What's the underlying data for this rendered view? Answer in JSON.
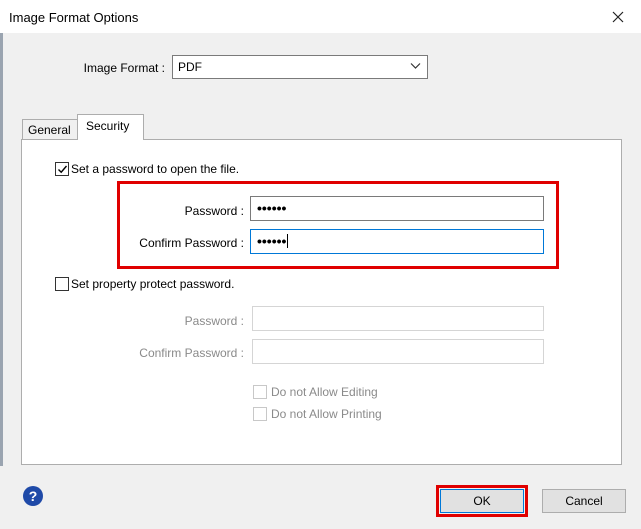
{
  "window": {
    "title": "Image Format Options"
  },
  "format": {
    "label": "Image Format :",
    "value": "PDF"
  },
  "tabs": {
    "general": "General",
    "security": "Security"
  },
  "open_password": {
    "checkbox_label": "Set a password to open the file.",
    "checked": true,
    "password_label": "Password :",
    "password_value": "••••••",
    "confirm_label": "Confirm Password :",
    "confirm_value": "••••••"
  },
  "property_password": {
    "checkbox_label": "Set property protect password.",
    "checked": false,
    "password_label": "Password :",
    "confirm_label": "Confirm Password :",
    "no_editing_label": "Do not Allow Editing",
    "no_printing_label": "Do not Allow Printing"
  },
  "buttons": {
    "ok": "OK",
    "cancel": "Cancel",
    "help": "?"
  },
  "colors": {
    "highlight": "#e00000",
    "focus": "#0078d7",
    "help": "#1f4aa8"
  }
}
